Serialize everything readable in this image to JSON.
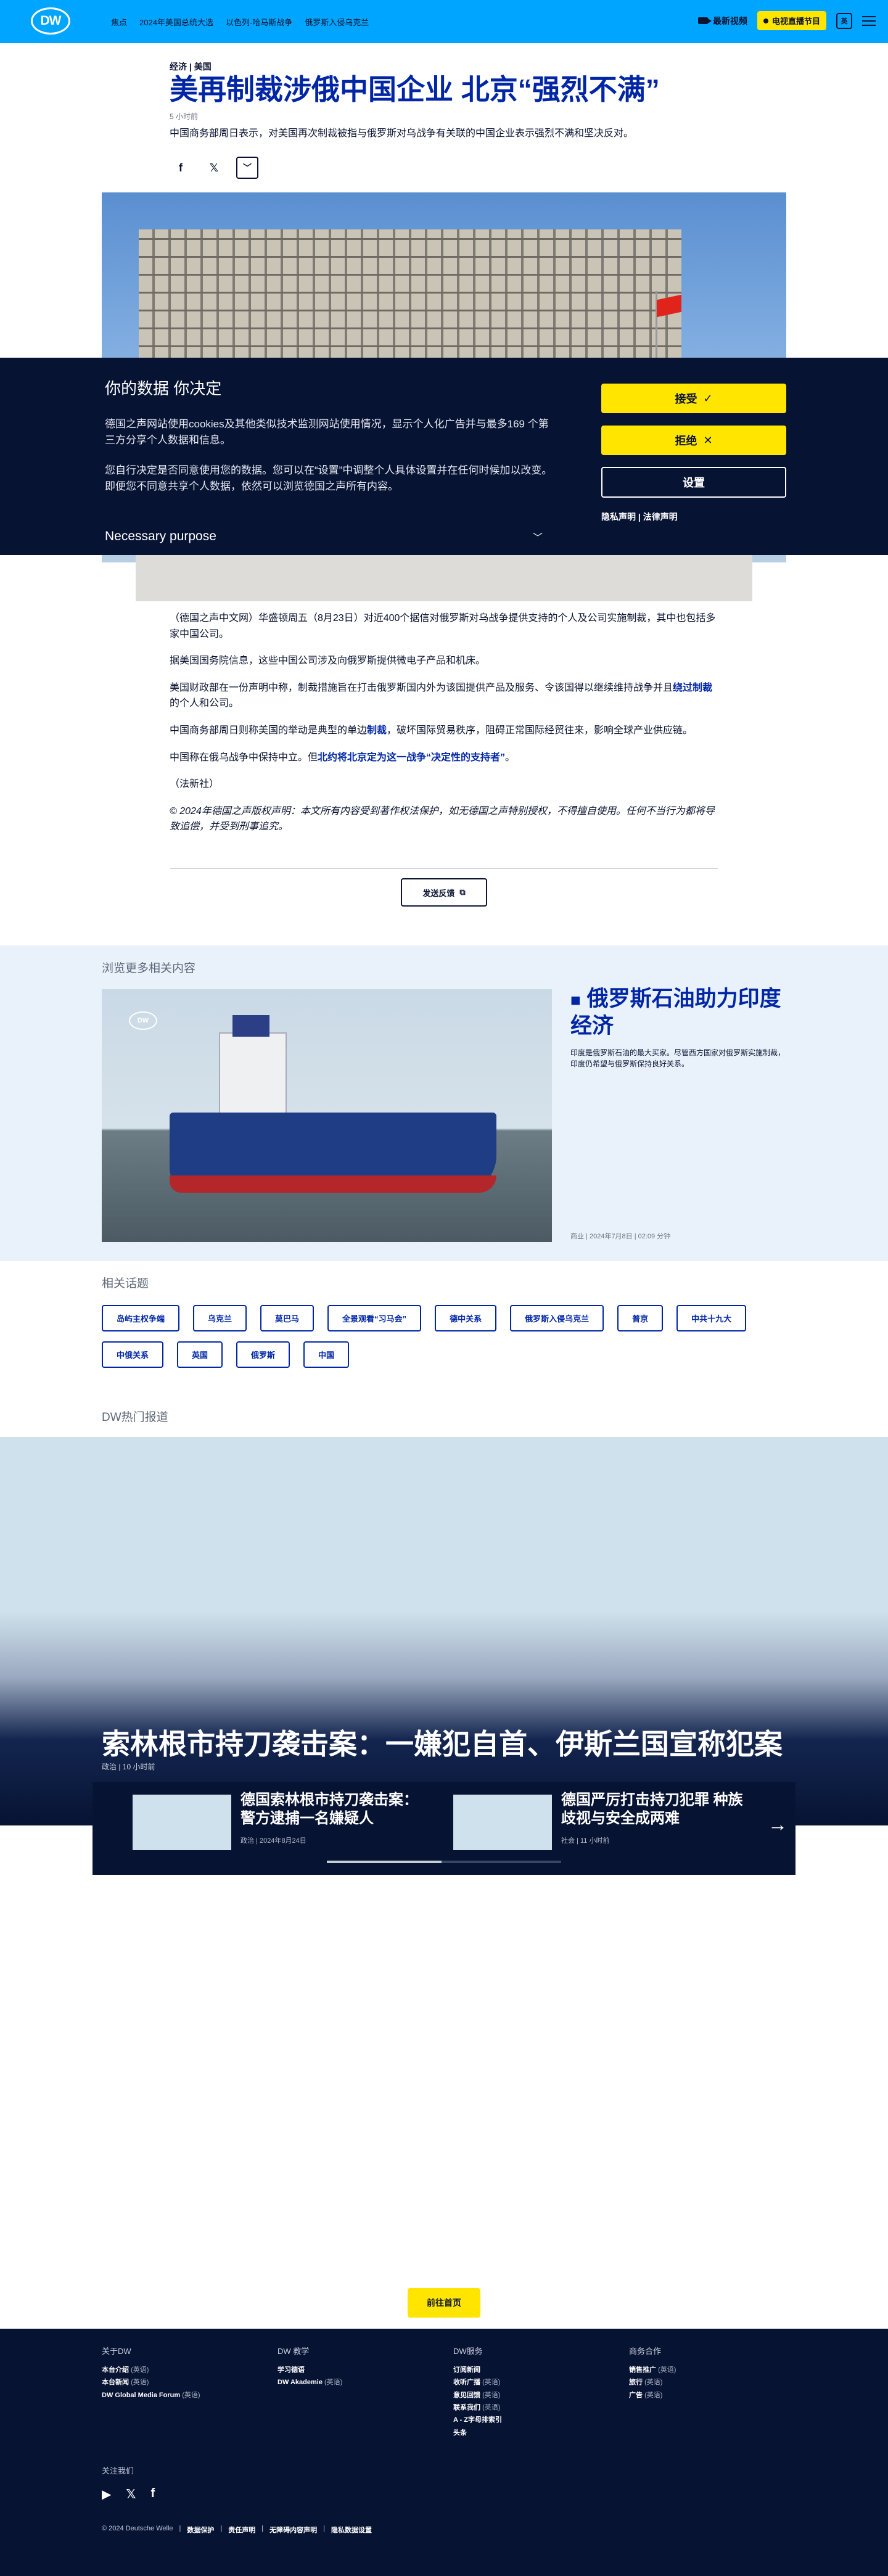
{
  "header": {
    "logo": "DW",
    "nav": [
      "焦点",
      "2024年美国总统大选",
      "以色列-哈马斯战争",
      "俄罗斯入侵乌克兰"
    ],
    "live_video": "最新视频",
    "tv_button": "电视直播节目",
    "lang": "英"
  },
  "article": {
    "kicker": "经济 | 美国",
    "title": "美再制裁涉俄中国企业 北京“强烈不满”",
    "age": "5 小时前",
    "lead": "中国商务部周日表示，对美国再次制裁被指与俄罗斯对乌战争有关联的中国企业表示强烈不满和坚决反对。",
    "share_icons": [
      "facebook-icon",
      "x-icon",
      "more-icon"
    ],
    "p1": "（德国之声中文网）华盛顿周五（8月23日）对近400个据信对俄罗斯对乌战争提供支持的个人及公司实施制裁，其中也包括多家中国公司。",
    "p2": "据美国国务院信息，这些中国公司涉及向俄罗斯提供微电子产品和机床。",
    "p3a": "美国财政部在一份声明中称，制裁措施旨在打击俄罗斯国内外为该国提供产品及服务、令该国得以继续维持战争并且",
    "p3b": "绕过制裁",
    "p3c": "的个人和公司。",
    "p4a": "中国商务部周日则称美国的举动是典型的单边",
    "p4b": "制裁",
    "p4c": "，破坏国际贸易秩序，阻碍正常国际经贸往来，影响全球产业供应链。",
    "p5a": "中国称在俄乌战争中保持中立。但",
    "p5b": "北约将北京定为这一战争“决定性的支持者”",
    "p5c": "。",
    "p6": "（法新社）",
    "copyright": "© 2024年德国之声版权声明：本文所有内容受到著作权法保护，如无德国之声特别授权，不得擅自使用。任何不当行为都将导致追偿，并受到刑事追究。",
    "feedback": "发送反馈"
  },
  "cookie": {
    "title": "你的数据 你决定",
    "p1": "德国之声网站使用cookies及其他类似技术监测网站使用情况，显示个人化广告并与最多169 个第三方分享个人数据和信息。",
    "p2": "您自行决定是否同意使用您的数据。您可以在“设置”中调整个人具体设置并在任何时候加以改变。即便您不同意共享个人数据，依然可以浏览德国之声所有内容。",
    "purpose": "Necessary purpose",
    "accept": "接受",
    "reject": "拒绝",
    "settings": "设置",
    "privacy": "隐私声明",
    "legal": "法律声明"
  },
  "related": {
    "heading": "浏览更多相关内容",
    "title": "俄罗斯石油助力印度经济",
    "desc": "印度是俄罗斯石油的最大买家。尽管西方国家对俄罗斯实施制裁，印度仍希望与俄罗斯保持良好关系。",
    "meta": "商业 | 2024年7月8日 | 02:09 分钟"
  },
  "topics": {
    "heading": "相关话题",
    "tags": [
      "岛屿主权争端",
      "乌克兰",
      "莫巴马",
      "全景观看“习马会”",
      "德中关系",
      "俄罗斯入侵乌克兰",
      "普京",
      "中共十九大",
      "中俄关系",
      "英国",
      "俄罗斯",
      "中国"
    ]
  },
  "top": {
    "heading": "DW热门报道",
    "title": "索林根市持刀袭击案：一嫌犯自首、伊斯兰国宣称犯案",
    "meta": "政治 | 10 小时前",
    "cards": [
      {
        "title": "德国索林根市持刀袭击案：警方逮捕一名嫌疑人",
        "meta": "政治 | 2024年8月24日"
      },
      {
        "title": "德国严厉打击持刀犯罪  种族歧视与安全成两难",
        "meta": "社会 | 11 小时前"
      }
    ]
  },
  "home_button": "前往首页",
  "footer": {
    "cols": [
      {
        "title": "关于DW",
        "items": [
          [
            "本台介绍",
            "(英语)"
          ],
          [
            "本台新闻",
            "(英语)"
          ],
          [
            "DW Global Media Forum",
            "(英语)"
          ]
        ]
      },
      {
        "title": "DW 教学",
        "items": [
          [
            "学习德语",
            ""
          ],
          [
            "DW Akademie",
            "(英语)"
          ]
        ]
      },
      {
        "title": "DW服务",
        "items": [
          [
            "订阅新闻",
            ""
          ],
          [
            "收听广播",
            "(英语)"
          ],
          [
            "意见回馈",
            "(英语)"
          ],
          [
            "联系我们",
            "(英语)"
          ],
          [
            "A - Z字母排索引",
            ""
          ],
          [
            "头条",
            ""
          ]
        ]
      },
      {
        "title": "商务合作",
        "items": [
          [
            "销售推广",
            "(英语)"
          ],
          [
            "旅行",
            "(英语)"
          ],
          [
            "广告",
            "(英语)"
          ]
        ]
      }
    ],
    "follow": "关注我们",
    "social": [
      "youtube-icon",
      "x-icon",
      "facebook-icon"
    ],
    "copyright": "© 2024 Deutsche Welle",
    "links": [
      "数据保护",
      "责任声明",
      "无障碍内容声明",
      "隐私数据设置"
    ]
  }
}
